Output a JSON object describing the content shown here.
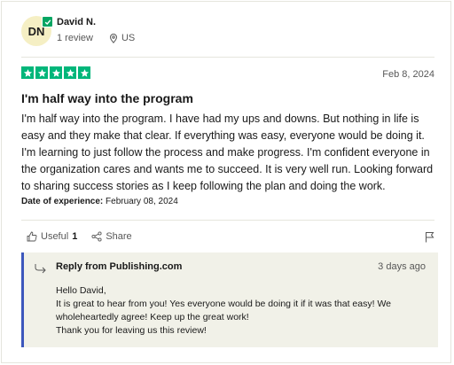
{
  "reviewer": {
    "initials": "DN",
    "name": "David N.",
    "review_count": "1 review",
    "location": "US"
  },
  "review": {
    "rating": 5,
    "rating_color": "#00b67a",
    "date": "Feb 8, 2024",
    "title": "I'm half way into the program",
    "body": "I'm half way into the program. I have had my ups and downs. But nothing in life is easy and they make that clear. If everything was easy, everyone would be doing it. I'm learning to just follow the process and make progress. I'm confident everyone in the organization cares and wants me to succeed. It is very well run. Looking forward to sharing success stories as I keep following the plan and doing the work.",
    "experience_label": "Date of experience:",
    "experience_date": "February 08, 2024"
  },
  "actions": {
    "useful_label": "Useful",
    "useful_count": "1",
    "share_label": "Share"
  },
  "reply": {
    "from": "Reply from Publishing.com",
    "time": "3 days ago",
    "accent_color": "#3c57bc",
    "lines": [
      "Hello David,",
      "It is great to hear from you! Yes everyone would be doing it if it was that easy! We",
      "wholeheartedly agree! Keep up the great work!",
      "Thank you for leaving us this review!"
    ]
  }
}
